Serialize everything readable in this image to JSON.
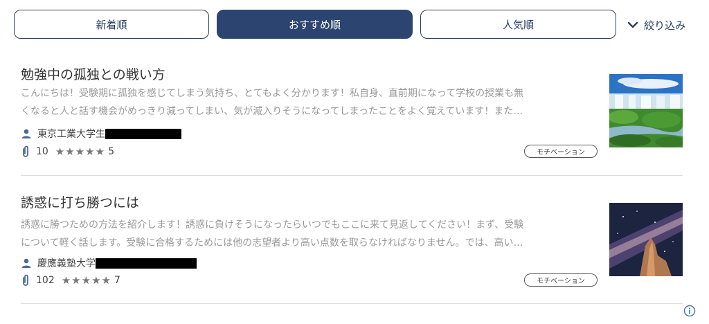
{
  "sort_tabs": {
    "newest": "新着順",
    "recommended": "おすすめ順",
    "popular": "人気順",
    "active": "recommended"
  },
  "filter": {
    "label": "絞り込み",
    "icon": "chevron-down-icon"
  },
  "articles": [
    {
      "title": "勉強中の孤独との戦い方",
      "excerpt_line1": "こんにちは！受験期に孤独を感じてしまう気持ち、とてもよく分かります！私自身、直前期になって学校の授業も無",
      "excerpt_line2": "くなると人と話す機会がめっきり減ってしまい、気が滅入りそうになってしまったことをよく覚えています！また…",
      "author": "東京工業大学生",
      "attachments": "10",
      "stars": "★★★★★",
      "rating": "5",
      "tag": "モチベーション",
      "thumbnail": "waterfall-landscape-image"
    },
    {
      "title": "誘惑に打ち勝つには",
      "excerpt_line1": "誘惑に勝つための方法を紹介します！誘惑に負けそうになったらいつでもここに来て見返してください！まず、受験",
      "excerpt_line2": "について軽く話します。受験に合格するためには他の志望者より高い点数を取らなければなりません。では、高い…",
      "author": "慶應義塾大学",
      "attachments": "102",
      "stars": "★★★★★",
      "rating": "7",
      "tag": "モチベーション",
      "thumbnail": "milky-way-rock-image"
    }
  ],
  "colors": {
    "primary": "#2c4470",
    "text": "#333333",
    "muted": "#999999",
    "info": "#4a7fc1"
  }
}
